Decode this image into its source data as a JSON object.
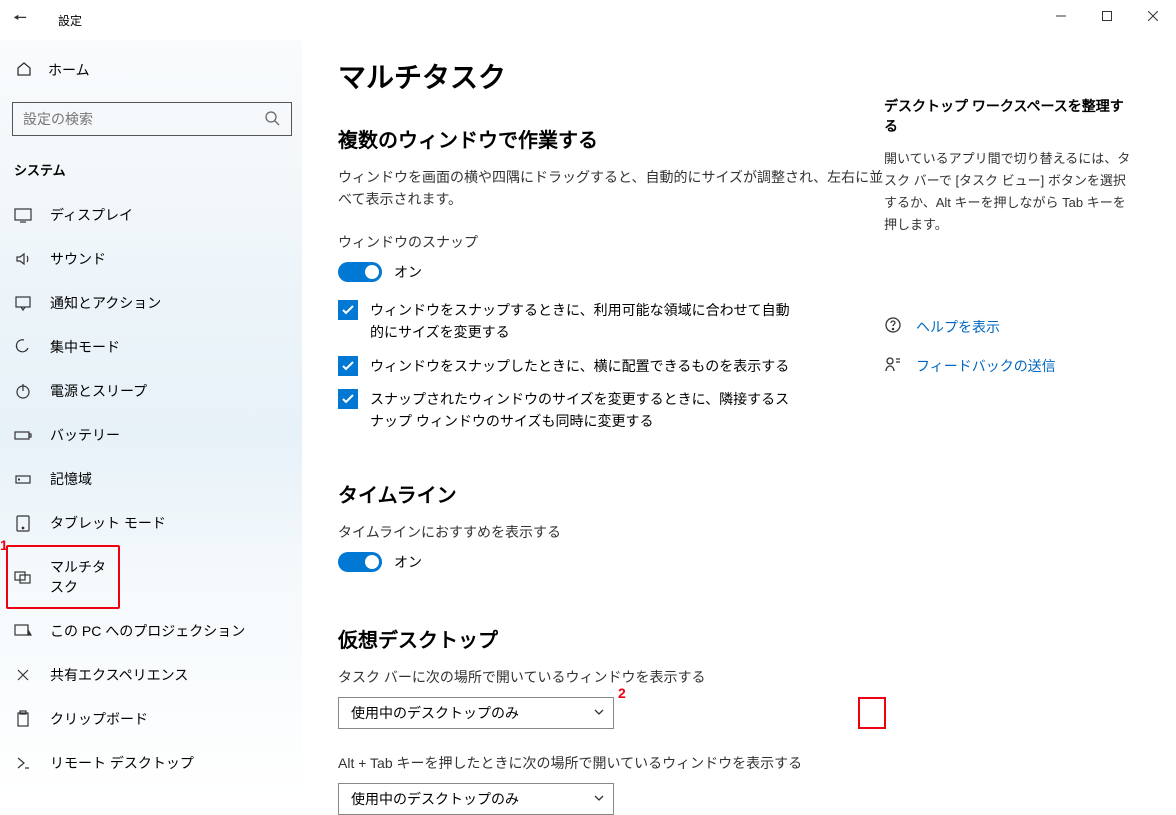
{
  "titlebar": {
    "title": "設定"
  },
  "sidebar": {
    "home": "ホーム",
    "search_placeholder": "設定の検索",
    "section": "システム",
    "items": [
      {
        "label": "ディスプレイ"
      },
      {
        "label": "サウンド"
      },
      {
        "label": "通知とアクション"
      },
      {
        "label": "集中モード"
      },
      {
        "label": "電源とスリープ"
      },
      {
        "label": "バッテリー"
      },
      {
        "label": "記憶域"
      },
      {
        "label": "タブレット モード"
      },
      {
        "label": "マルチタスク"
      },
      {
        "label": "この PC へのプロジェクション"
      },
      {
        "label": "共有エクスペリエンス"
      },
      {
        "label": "クリップボード"
      },
      {
        "label": "リモート デスクトップ"
      }
    ]
  },
  "annotations": {
    "one": "1",
    "two": "2"
  },
  "main": {
    "title": "マルチタスク",
    "snap": {
      "heading": "複数のウィンドウで作業する",
      "desc": "ウィンドウを画面の横や四隅にドラッグすると、自動的にサイズが調整され、左右に並べて表示されます。",
      "toggle_label": "ウィンドウのスナップ",
      "state": "オン",
      "check1": "ウィンドウをスナップするときに、利用可能な領域に合わせて自動的にサイズを変更する",
      "check2": "ウィンドウをスナップしたときに、横に配置できるものを表示する",
      "check3": "スナップされたウィンドウのサイズを変更するときに、隣接するスナップ ウィンドウのサイズも同時に変更する"
    },
    "timeline": {
      "heading": "タイムライン",
      "toggle_label": "タイムラインにおすすめを表示する",
      "state": "オン"
    },
    "vdesktop": {
      "heading": "仮想デスクトップ",
      "label1": "タスク バーに次の場所で開いているウィンドウを表示する",
      "value1": "使用中のデスクトップのみ",
      "label2": "Alt + Tab キーを押したときに次の場所で開いているウィンドウを表示する",
      "value2": "使用中のデスクトップのみ"
    }
  },
  "right": {
    "heading": "デスクトップ ワークスペースを整理する",
    "desc": "開いているアプリ間で切り替えるには、タスク バーで [タスク ビュー] ボタンを選択するか、Alt キーを押しながら Tab キーを押します。",
    "help": "ヘルプを表示",
    "feedback": "フィードバックの送信"
  }
}
